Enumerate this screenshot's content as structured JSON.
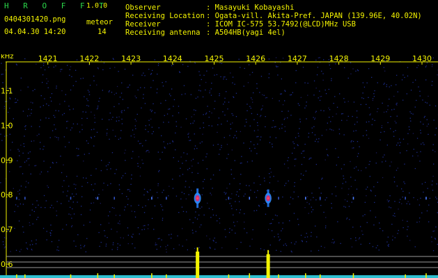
{
  "app": {
    "name": "H R O F F T",
    "version": "1.0.0"
  },
  "file": {
    "name": "0404301420.png",
    "timestamp": "04.04.30 14:20"
  },
  "counter": {
    "label": "meteor",
    "value": "14"
  },
  "info": [
    {
      "label": "Observer",
      "value": ": Masayuki Kobayashi"
    },
    {
      "label": "Receiving Location",
      "value": ": Ogata-vill. Akita-Pref. JAPAN (139.96E, 40.02N)"
    },
    {
      "label": "Receiver",
      "value": ": ICOM IC-575 53.7492(@LCD)MHz USB"
    },
    {
      "label": "Receiving antenna",
      "value": ": A504HB(yagi 4el)"
    }
  ],
  "colors": {
    "text": "#f4f400",
    "title": "#2bd84a",
    "axis": "#f4f400",
    "echo": "#f4f400",
    "noise": "#1c2c8c"
  },
  "chart_data": {
    "type": "heatmap",
    "x_ticks": [
      "1421",
      "1422",
      "1423",
      "1424",
      "1425",
      "1426",
      "1427",
      "1428",
      "1429",
      "1430"
    ],
    "y_ticks": [
      "0.6",
      "0.7",
      "0.8",
      "0.9",
      "1.0",
      "1.1"
    ],
    "y_unit": "kHz",
    "echo_frequency_khz": 0.79,
    "echoes": [
      {
        "time": 1420.25,
        "strength": 0.2
      },
      {
        "time": 1420.45,
        "strength": 0.2
      },
      {
        "time": 1421.55,
        "strength": 0.2
      },
      {
        "time": 1422.2,
        "strength": 0.3
      },
      {
        "time": 1422.6,
        "strength": 0.2
      },
      {
        "time": 1423.5,
        "strength": 0.3
      },
      {
        "time": 1423.85,
        "strength": 0.2
      },
      {
        "time": 1424.6,
        "strength": 1.0
      },
      {
        "time": 1425.35,
        "strength": 0.2
      },
      {
        "time": 1425.85,
        "strength": 0.3
      },
      {
        "time": 1426.3,
        "strength": 0.9
      },
      {
        "time": 1426.55,
        "strength": 0.2
      },
      {
        "time": 1427.2,
        "strength": 0.3
      },
      {
        "time": 1427.55,
        "strength": 0.2
      },
      {
        "time": 1428.35,
        "strength": 0.3
      },
      {
        "time": 1429.6,
        "strength": 0.2
      },
      {
        "time": 1430.1,
        "strength": 0.3
      }
    ]
  }
}
